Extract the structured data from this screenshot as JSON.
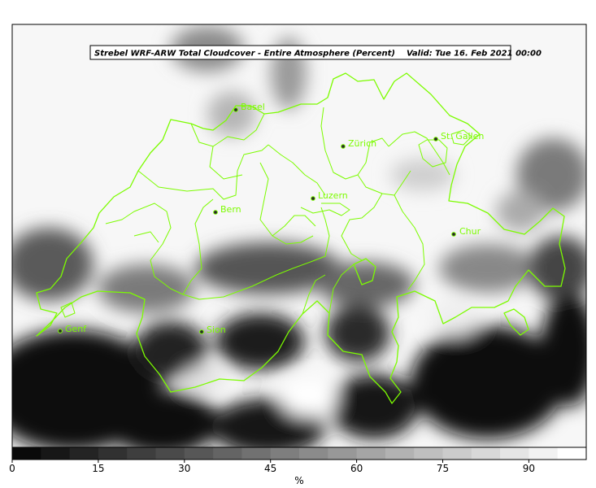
{
  "map": {
    "title": "Strebel WRF-ARW Total Cloudcover - Entire Atmosphere (Percent)",
    "valid": "Valid: Tue 16. Feb 2021 00:00",
    "colors": {
      "border": "#7cfc00",
      "label": "#7cfc00",
      "cloud_low": "#0a0a0a",
      "cloud_high": "#ffffff"
    },
    "cities": [
      {
        "name": "Basel"
      },
      {
        "name": "Zürich"
      },
      {
        "name": "St. Gallen"
      },
      {
        "name": "Luzern"
      },
      {
        "name": "Bern"
      },
      {
        "name": "Chur"
      },
      {
        "name": "Genf"
      },
      {
        "name": "Sion"
      }
    ]
  },
  "colorbar": {
    "unit": "%",
    "min": 0,
    "max": 100,
    "step": 5,
    "ticks": [
      "0",
      "15",
      "30",
      "45",
      "60",
      "75",
      "90"
    ]
  }
}
